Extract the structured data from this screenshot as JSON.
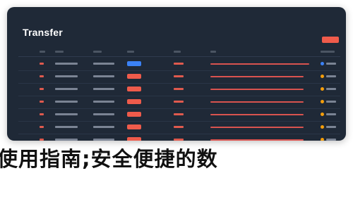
{
  "window": {
    "title": "Transfer",
    "action_label": ""
  },
  "table": {
    "headers": [
      "",
      "",
      "",
      "",
      "",
      "",
      ""
    ],
    "rows": [
      {
        "id": "",
        "date": "",
        "from": "",
        "badge": "",
        "badge_color": "#3b82f6",
        "value": "",
        "desc": "",
        "status": "",
        "dot_color": "#3b82f6"
      },
      {
        "id": "",
        "date": "",
        "from": "",
        "badge": "",
        "badge_color": "#ef5b4b",
        "value": "",
        "desc": "",
        "status": "",
        "dot_color": "#f59e0b"
      },
      {
        "id": "",
        "date": "",
        "from": "",
        "badge": "",
        "badge_color": "#ef5b4b",
        "value": "",
        "desc": "",
        "status": "",
        "dot_color": "#f59e0b"
      },
      {
        "id": "",
        "date": "",
        "from": "",
        "badge": "",
        "badge_color": "#ef5b4b",
        "value": "",
        "desc": "",
        "status": "",
        "dot_color": "#f59e0b"
      },
      {
        "id": "",
        "date": "",
        "from": "",
        "badge": "",
        "badge_color": "#ef5b4b",
        "value": "",
        "desc": "",
        "status": "",
        "dot_color": "#f59e0b"
      },
      {
        "id": "",
        "date": "",
        "from": "",
        "badge": "",
        "badge_color": "#ef5b4b",
        "value": "",
        "desc": "",
        "status": "",
        "dot_color": "#f59e0b"
      },
      {
        "id": "",
        "date": "",
        "from": "",
        "badge": "",
        "badge_color": "#ef5b4b",
        "value": "",
        "desc": "",
        "status": "",
        "dot_color": "#f59e0b"
      }
    ]
  },
  "caption": "使用指南;安全便捷的数"
}
